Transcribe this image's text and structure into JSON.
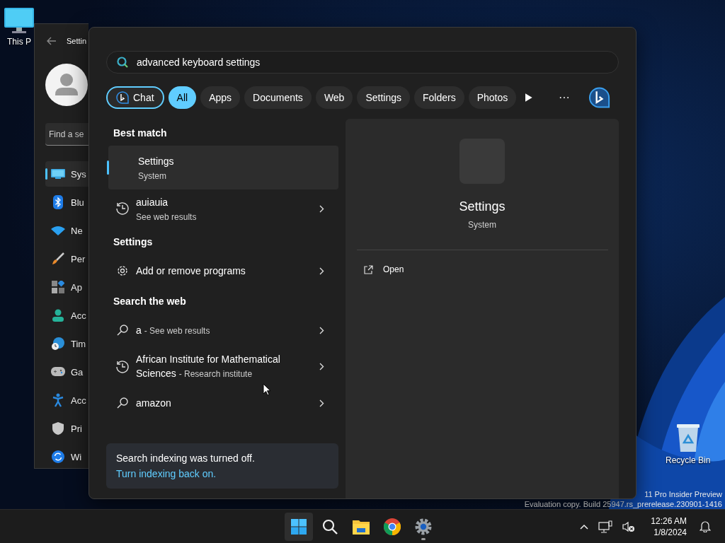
{
  "desktop": {
    "icons": [
      {
        "kind": "computer",
        "label": "This P"
      },
      {
        "kind": "recycle",
        "label": "Recycle Bin"
      }
    ],
    "watermark": [
      "11 Pro Insider Preview",
      "Evaluation copy. Build 25947.rs_prerelease.230901-1416"
    ]
  },
  "settings_window": {
    "title": "Settin",
    "search": {
      "placeholder": "Find a se"
    },
    "nav": [
      {
        "kind": "system",
        "label": "Sys",
        "selected": true
      },
      {
        "kind": "bluetooth",
        "label": "Blu",
        "selected": false
      },
      {
        "kind": "network",
        "label": "Ne",
        "selected": false
      },
      {
        "kind": "personalization",
        "label": "Per",
        "selected": false
      },
      {
        "kind": "apps",
        "label": "Ap",
        "selected": false
      },
      {
        "kind": "accounts",
        "label": "Acc",
        "selected": false
      },
      {
        "kind": "time",
        "label": "Tim",
        "selected": false
      },
      {
        "kind": "gaming",
        "label": "Ga",
        "selected": false
      },
      {
        "kind": "accessibility",
        "label": "Acc",
        "selected": false
      },
      {
        "kind": "privacy",
        "label": "Pri",
        "selected": false
      },
      {
        "kind": "update",
        "label": "Wi",
        "selected": false
      }
    ]
  },
  "search": {
    "query": "advanced keyboard settings",
    "filters": [
      {
        "kind": "chat",
        "label": "Chat",
        "selected": false
      },
      {
        "kind": "text",
        "label": "All",
        "selected": true
      },
      {
        "kind": "text",
        "label": "Apps",
        "selected": false
      },
      {
        "kind": "text",
        "label": "Documents",
        "selected": false
      },
      {
        "kind": "text",
        "label": "Web",
        "selected": false
      },
      {
        "kind": "text",
        "label": "Settings",
        "selected": false
      },
      {
        "kind": "text",
        "label": "Folders",
        "selected": false
      },
      {
        "kind": "text",
        "label": "Photos",
        "selected": false
      }
    ],
    "more": "···",
    "sections": [
      {
        "heading": "Best match",
        "results": [
          {
            "kind": "app",
            "title": "Settings",
            "subtitle": "System",
            "inline": false,
            "selected": true
          }
        ]
      },
      {
        "results": [
          {
            "kind": "history",
            "title": "auiauia",
            "subtitle": "See web results",
            "inline": false,
            "selected": false
          }
        ]
      },
      {
        "heading": "Settings",
        "results": [
          {
            "kind": "setting",
            "title": "Add or remove programs",
            "selected": false
          }
        ]
      },
      {
        "heading": "Search the web",
        "results": [
          {
            "kind": "web",
            "title": "a",
            "subtitle": "- See web results",
            "inline": true,
            "selected": false
          },
          {
            "kind": "history",
            "title": "African Institute for Mathematical Sciences",
            "subtitle": "- Research institute",
            "inline": true,
            "selected": false
          },
          {
            "kind": "web",
            "title": "amazon",
            "selected": false
          }
        ]
      }
    ],
    "notice": {
      "text": "Search indexing was turned off.",
      "link": "Turn indexing back on."
    },
    "preview": {
      "title": "Settings",
      "subtitle": "System",
      "actions": [
        {
          "kind": "open",
          "label": "Open"
        }
      ]
    }
  },
  "taskbar": {
    "apps": [
      {
        "kind": "start",
        "selected": true,
        "running": false
      },
      {
        "kind": "search",
        "selected": false,
        "running": false
      },
      {
        "kind": "explorer",
        "selected": false,
        "running": false
      },
      {
        "kind": "chrome",
        "selected": false,
        "running": false
      },
      {
        "kind": "settings",
        "selected": false,
        "running": true
      }
    ],
    "time": "12:26 AM",
    "date": "1/8/2024"
  }
}
